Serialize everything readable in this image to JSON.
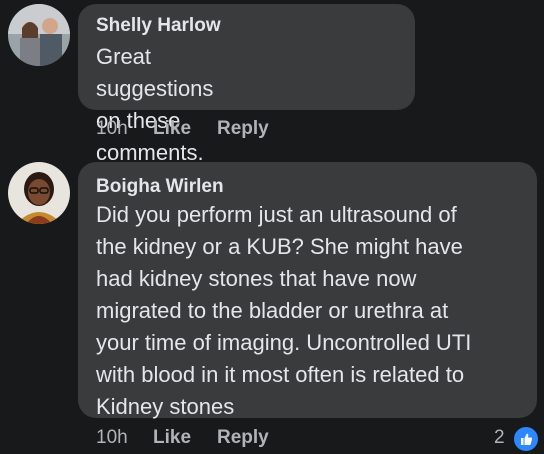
{
  "comments": [
    {
      "author": "Shelly Harlow",
      "text_lines": [
        "Great suggestions on these",
        "comments."
      ],
      "time": "10h",
      "like_label": "Like",
      "reply_label": "Reply"
    },
    {
      "author": "Boigha Wirlen",
      "text_lines": [
        "Did you perform just an ultrasound of",
        "the kidney or a KUB? She might have",
        "had kidney stones that have now",
        "migrated to the bladder or urethra at",
        "your time of imaging. Uncontrolled UTI",
        "with blood in it most often is related to",
        "Kidney stones"
      ],
      "time": "10h",
      "like_label": "Like",
      "reply_label": "Reply",
      "reaction_count": "2",
      "reaction_icon": "thumbs-up-icon"
    }
  ],
  "colors": {
    "background": "#18191a",
    "bubble": "#3a3b3c",
    "text": "#e4e6eb",
    "meta": "#b0b3b8",
    "reaction_blue": "#2d88ff"
  }
}
